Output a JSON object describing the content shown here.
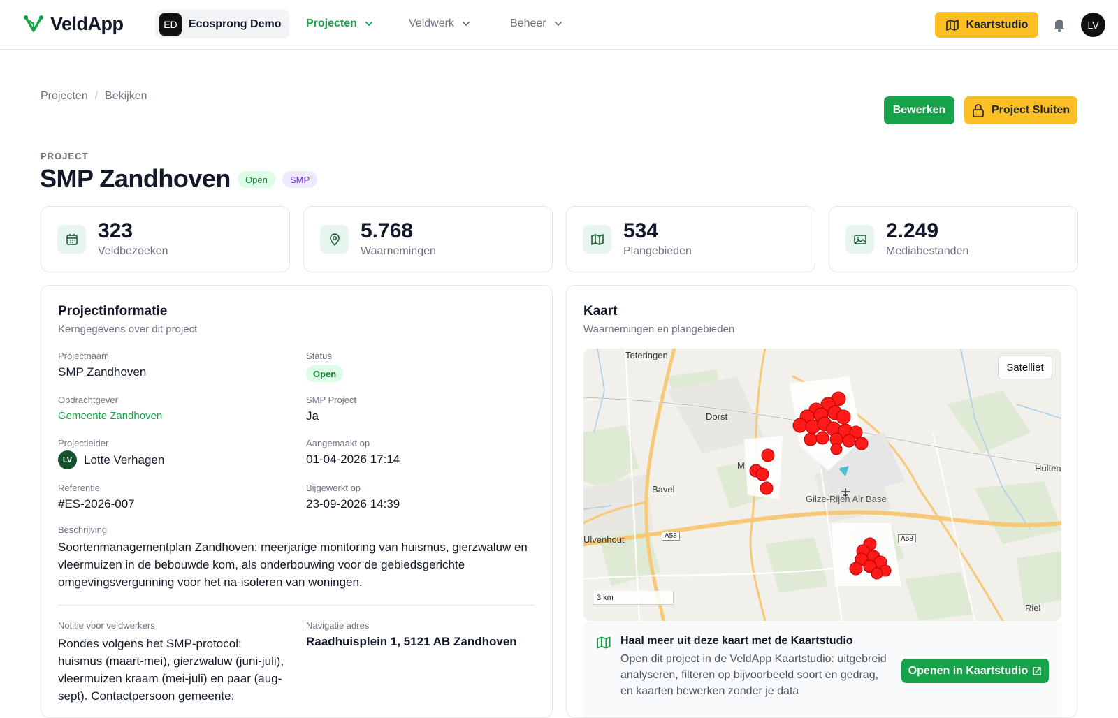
{
  "app": {
    "name": "VeldApp"
  },
  "org": {
    "badge": "ED",
    "name": "Ecosprong Demo"
  },
  "nav": [
    {
      "label": "Projecten",
      "active": true
    },
    {
      "label": "Veldwerk",
      "active": false
    },
    {
      "label": "Beheer",
      "active": false
    }
  ],
  "header": {
    "studio_label": "Kaartstudio",
    "user_initials": "LV"
  },
  "breadcrumb": [
    "Projecten",
    "Bekijken"
  ],
  "actions": {
    "edit": "Bewerken",
    "close": "Project Sluiten"
  },
  "project": {
    "eyebrow": "PROJECT",
    "title": "SMP Zandhoven",
    "badges": {
      "status": "Open",
      "type": "SMP"
    }
  },
  "stats": [
    {
      "value": "323",
      "label": "Veldbezoeken",
      "icon": "calendar-icon"
    },
    {
      "value": "5.768",
      "label": "Waarnemingen",
      "icon": "map-pin-icon"
    },
    {
      "value": "534",
      "label": "Plangebieden",
      "icon": "map-icon"
    },
    {
      "value": "2.249",
      "label": "Mediabestanden",
      "icon": "image-icon"
    }
  ],
  "info": {
    "title": "Projectinformatie",
    "subtitle": "Kerngegevens over dit project",
    "fields": {
      "name": {
        "label": "Projectnaam",
        "value": "SMP Zandhoven"
      },
      "status": {
        "label": "Status",
        "value": "Open"
      },
      "client": {
        "label": "Opdrachtgever",
        "value": "Gemeente Zandhoven"
      },
      "smp": {
        "label": "SMP Project",
        "value": "Ja"
      },
      "lead": {
        "label": "Projectleider",
        "initials": "LV",
        "value": "Lotte Verhagen"
      },
      "created": {
        "label": "Aangemaakt op",
        "value": "01-04-2026 17:14"
      },
      "ref": {
        "label": "Referentie",
        "value": "#ES-2026-007"
      },
      "updated": {
        "label": "Bijgewerkt op",
        "value": "23-09-2026 14:39"
      },
      "desc": {
        "label": "Beschrijving",
        "value": "Soortenmanagementplan Zandhoven: meerjarige monitoring van huismus, gierzwaluw en vleermuizen in de bebouwde kom, als onderbouwing voor de gebiedsgerichte omgevingsvergunning voor het na-isoleren van woningen."
      },
      "note": {
        "label": "Notitie voor veldwerkers",
        "value": "Rondes volgens het SMP-protocol: huismus (maart-mei), gierzwaluw (juni-juli), vleermuizen kraam (mei-juli) en paar (aug-sept). Contactpersoon gemeente:"
      },
      "address": {
        "label": "Navigatie adres",
        "value": "Raadhuisplein 1, 5121 AB Zandhoven"
      }
    }
  },
  "map": {
    "title": "Kaart",
    "subtitle": "Waarnemingen en plangebieden",
    "satellite_label": "Satelliet",
    "scale": "3 km",
    "places": [
      "Teteringen",
      "Dorst",
      "Bavel",
      "Hulten",
      "Gilze-Rijen Air Base",
      "Ulvenhout",
      "Riel",
      "M"
    ],
    "roads": [
      "A58",
      "A58"
    ],
    "cta": {
      "title": "Haal meer uit deze kaart met de Kaartstudio",
      "text": "Open dit project in de VeldApp Kaartstudio: uitgebreid analyseren, filteren op bijvoorbeeld soort en gedrag, en kaarten bewerken zonder je data",
      "button": "Openen in Kaartstudio"
    }
  },
  "colors": {
    "brand_green": "#16a34a",
    "accent_yellow": "#fbbf24",
    "marker_red": "#ff0000"
  }
}
